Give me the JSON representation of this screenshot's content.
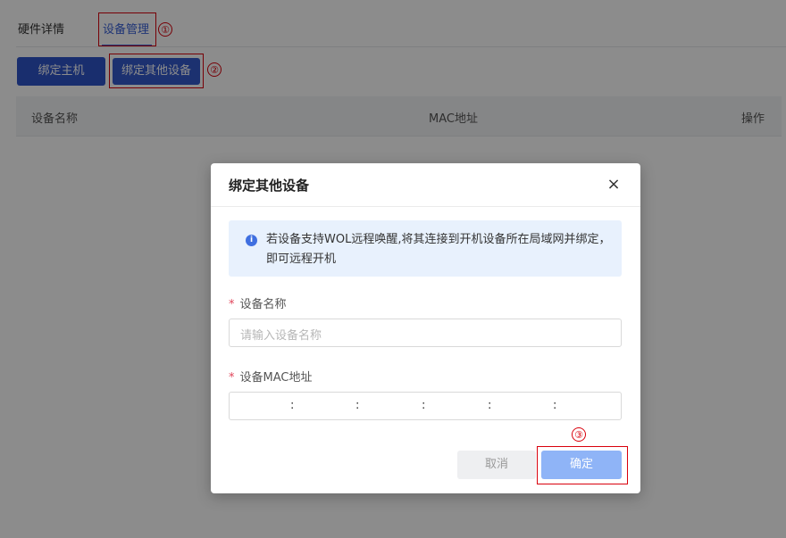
{
  "tabs": [
    {
      "label": "硬件详情"
    },
    {
      "label": "设备管理"
    }
  ],
  "toolbar": {
    "bind_host_label": "绑定主机",
    "bind_other_label": "绑定其他设备"
  },
  "table": {
    "columns": [
      "设备名称",
      "MAC地址",
      "操作"
    ]
  },
  "annotations": [
    "①",
    "②",
    "③"
  ],
  "modal": {
    "title": "绑定其他设备",
    "close_icon": "×",
    "info_icon": "i",
    "info_text": "若设备支持WOL远程唤醒,将其连接到开机设备所在局域网并绑定，即可远程开机",
    "name_field": {
      "required_mark": "*",
      "label": "设备名称",
      "placeholder": "请输入设备名称"
    },
    "mac_field": {
      "required_mark": "*",
      "label": "设备MAC地址",
      "separator": ":"
    },
    "cancel_label": "取消",
    "ok_label": "确定"
  },
  "colors": {
    "accent": "#3a62d7",
    "primary_button": "#2f54c9",
    "ok_button": "#8fb4f7",
    "annotation_red": "#d9000c",
    "info_bg": "#e8f1fd"
  }
}
